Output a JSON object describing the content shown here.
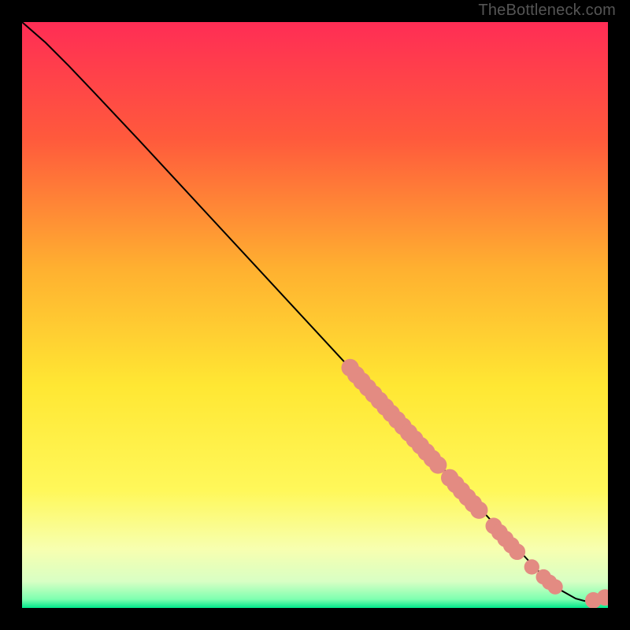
{
  "watermark": "TheBottleneck.com",
  "chart_data": {
    "type": "line",
    "title": "",
    "xlabel": "",
    "ylabel": "",
    "xlim": [
      0,
      100
    ],
    "ylim": [
      0,
      100
    ],
    "background_gradient_stops": [
      {
        "offset": 0,
        "color": "#ff2d55"
      },
      {
        "offset": 0.2,
        "color": "#ff5a3c"
      },
      {
        "offset": 0.42,
        "color": "#ffb030"
      },
      {
        "offset": 0.62,
        "color": "#ffe733"
      },
      {
        "offset": 0.8,
        "color": "#fff85a"
      },
      {
        "offset": 0.9,
        "color": "#f7ffb0"
      },
      {
        "offset": 0.955,
        "color": "#d8ffc4"
      },
      {
        "offset": 0.985,
        "color": "#7fffb0"
      },
      {
        "offset": 1.0,
        "color": "#00e68a"
      }
    ],
    "series": [
      {
        "name": "curve",
        "stroke": "#000000",
        "points": [
          {
            "x": 0,
            "y": 100
          },
          {
            "x": 4,
            "y": 96.5
          },
          {
            "x": 8,
            "y": 92.5
          },
          {
            "x": 12,
            "y": 88.3
          },
          {
            "x": 20,
            "y": 79.8
          },
          {
            "x": 30,
            "y": 69.0
          },
          {
            "x": 40,
            "y": 58.2
          },
          {
            "x": 50,
            "y": 47.4
          },
          {
            "x": 60,
            "y": 36.6
          },
          {
            "x": 70,
            "y": 25.8
          },
          {
            "x": 80,
            "y": 15.0
          },
          {
            "x": 88,
            "y": 6.4
          },
          {
            "x": 92,
            "y": 3.0
          },
          {
            "x": 94.5,
            "y": 1.6
          },
          {
            "x": 96,
            "y": 1.2
          },
          {
            "x": 98,
            "y": 1.3
          },
          {
            "x": 99.5,
            "y": 1.8
          }
        ]
      }
    ],
    "scatter": {
      "name": "highlight-dots",
      "fill": "#e38b82",
      "points": [
        {
          "x": 56.0,
          "y": 41.0,
          "r": 1.5
        },
        {
          "x": 57.0,
          "y": 39.8,
          "r": 1.5
        },
        {
          "x": 58.0,
          "y": 38.7,
          "r": 1.5
        },
        {
          "x": 59.0,
          "y": 37.6,
          "r": 1.5
        },
        {
          "x": 60.0,
          "y": 36.5,
          "r": 1.5
        },
        {
          "x": 61.0,
          "y": 35.4,
          "r": 1.5
        },
        {
          "x": 62.0,
          "y": 34.3,
          "r": 1.5
        },
        {
          "x": 63.0,
          "y": 33.2,
          "r": 1.5
        },
        {
          "x": 64.0,
          "y": 32.1,
          "r": 1.5
        },
        {
          "x": 65.0,
          "y": 31.0,
          "r": 1.5
        },
        {
          "x": 66.0,
          "y": 29.9,
          "r": 1.5
        },
        {
          "x": 67.0,
          "y": 28.8,
          "r": 1.5
        },
        {
          "x": 68.0,
          "y": 27.7,
          "r": 1.5
        },
        {
          "x": 69.0,
          "y": 26.6,
          "r": 1.5
        },
        {
          "x": 70.0,
          "y": 25.5,
          "r": 1.5
        },
        {
          "x": 71.0,
          "y": 24.4,
          "r": 1.5
        },
        {
          "x": 73.0,
          "y": 22.2,
          "r": 1.5
        },
        {
          "x": 74.0,
          "y": 21.1,
          "r": 1.5
        },
        {
          "x": 75.0,
          "y": 20.0,
          "r": 1.5
        },
        {
          "x": 76.0,
          "y": 18.9,
          "r": 1.5
        },
        {
          "x": 77.0,
          "y": 17.8,
          "r": 1.5
        },
        {
          "x": 78.0,
          "y": 16.7,
          "r": 1.5
        },
        {
          "x": 80.5,
          "y": 14.0,
          "r": 1.4
        },
        {
          "x": 81.5,
          "y": 12.9,
          "r": 1.4
        },
        {
          "x": 82.5,
          "y": 11.8,
          "r": 1.4
        },
        {
          "x": 83.5,
          "y": 10.7,
          "r": 1.4
        },
        {
          "x": 84.5,
          "y": 9.6,
          "r": 1.4
        },
        {
          "x": 87.0,
          "y": 7.0,
          "r": 1.3
        },
        {
          "x": 89.0,
          "y": 5.3,
          "r": 1.3
        },
        {
          "x": 90.0,
          "y": 4.4,
          "r": 1.3
        },
        {
          "x": 91.0,
          "y": 3.6,
          "r": 1.3
        },
        {
          "x": 97.5,
          "y": 1.3,
          "r": 1.4
        },
        {
          "x": 99.5,
          "y": 1.8,
          "r": 1.4
        }
      ]
    }
  }
}
